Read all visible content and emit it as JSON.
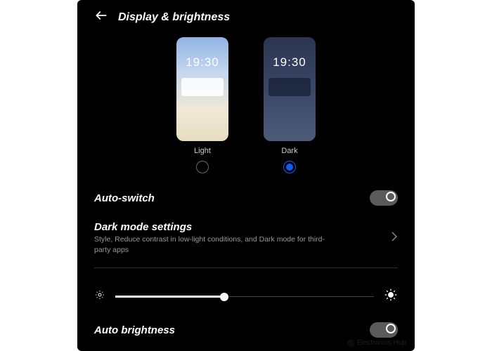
{
  "header": {
    "title": "Display & brightness"
  },
  "themes": {
    "light": {
      "label": "Light",
      "time": "19:30",
      "selected": false
    },
    "dark": {
      "label": "Dark",
      "time": "19:30",
      "selected": true
    }
  },
  "auto_switch": {
    "label": "Auto-switch",
    "value": false
  },
  "dark_mode_settings": {
    "title": "Dark mode settings",
    "subtitle": "Style, Reduce contrast in low-light conditions, and Dark mode for third-party apps"
  },
  "brightness": {
    "value_percent": 42
  },
  "auto_brightness": {
    "label": "Auto brightness",
    "value": false
  },
  "watermark": "Electronics Hub",
  "colors": {
    "accent": "#0a5dff",
    "background": "#000000",
    "text": "#ffffff",
    "muted": "#999999"
  }
}
